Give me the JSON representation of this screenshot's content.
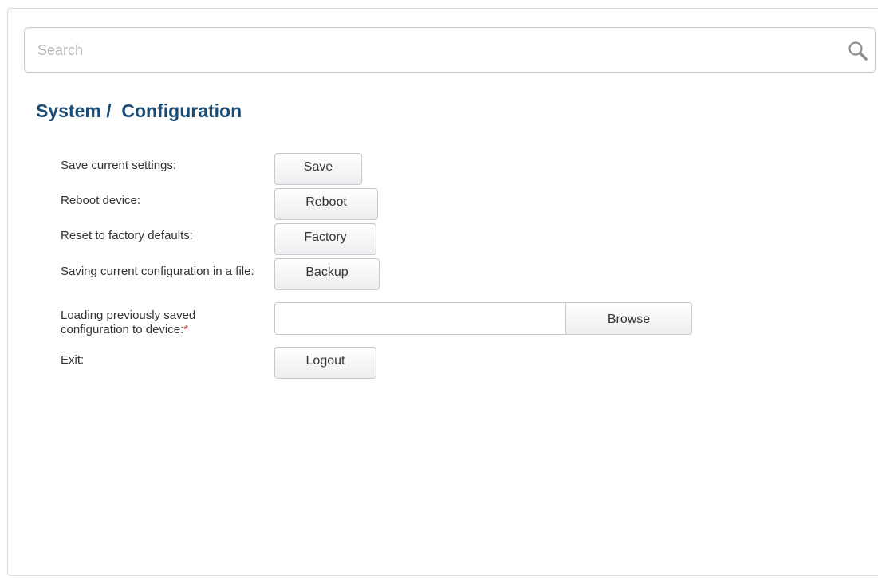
{
  "search": {
    "placeholder": "Search",
    "icon": "search-icon"
  },
  "page": {
    "title": "System /  Configuration"
  },
  "rows": [
    {
      "label": "Save current settings:",
      "button": "Save"
    },
    {
      "label": "Reboot device:",
      "button": "Reboot"
    },
    {
      "label": "Reset to factory defaults:",
      "button": "Factory"
    },
    {
      "label": "Saving current configuration in a file:",
      "button": "Backup"
    },
    {
      "label": "Loading previously saved configuration to device:",
      "required_marker": "*",
      "button": "Browse"
    },
    {
      "label": "Exit:",
      "button": "Logout"
    }
  ],
  "colors": {
    "title": "#1b4a73",
    "required": "#d23a3a",
    "border": "#c5c9cd"
  }
}
